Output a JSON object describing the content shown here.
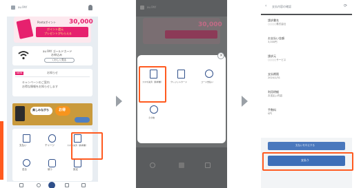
{
  "panel1": {
    "header": {
      "title": "au PAY"
    },
    "points_banner": {
      "label": "Pontaポイント",
      "amount": "30,000",
      "line1": "ポイント還元",
      "line2": "プレゼントがもらえる"
    },
    "wifi_card": {
      "line1": "au PAY ゴールドカード",
      "line2": "お申込み",
      "button": "くわしく見る"
    },
    "notice_card": {
      "badge": "NEW",
      "title": "お知らせ",
      "line1": "キャンペーンのご案内",
      "line2": "お得な情報をお知らせします"
    },
    "promo_banner": {
      "text1": "楽しみながら",
      "text2": "お得"
    },
    "grid": [
      {
        "label": "支払い"
      },
      {
        "label": "チャージ"
      },
      {
        "label": "スマホ決済（請求書）"
      },
      {
        "label": "送る"
      },
      {
        "label": "使う"
      },
      {
        "label": "設定"
      }
    ],
    "bottom_nav": [
      "ホーム",
      "ポイント",
      "支払い",
      "履歴",
      "その他"
    ]
  },
  "panel2": {
    "header": {
      "title": "au PAY"
    },
    "amount": "30,000",
    "close_label": "×",
    "menu_items": [
      {
        "label": "スマホ決済（請求書）"
      },
      {
        "label": "クレジットカード"
      },
      {
        "label": "コード支払い"
      },
      {
        "label": "その他"
      }
    ]
  },
  "panel3": {
    "header": {
      "title": "支払内容の確認"
    },
    "fields": [
      {
        "label": "請求書名",
        "value": "○○○○株式会社"
      },
      {
        "label": "お支払い金額",
        "value": "3,000円"
      },
      {
        "label": "請求元",
        "value": "○○○○サービス"
      },
      {
        "label": "支払期限",
        "value": "2024/1/31"
      },
      {
        "label": "利用明細",
        "value": "お支払い内容"
      },
      {
        "label": "手数料",
        "value": "0円"
      }
    ],
    "secondary_button": "支払いを中止する",
    "primary_button": "支払う"
  },
  "colors": {
    "highlight": "#ff5a1f",
    "primary": "#3d6fb8",
    "pink": "#e6216e"
  }
}
